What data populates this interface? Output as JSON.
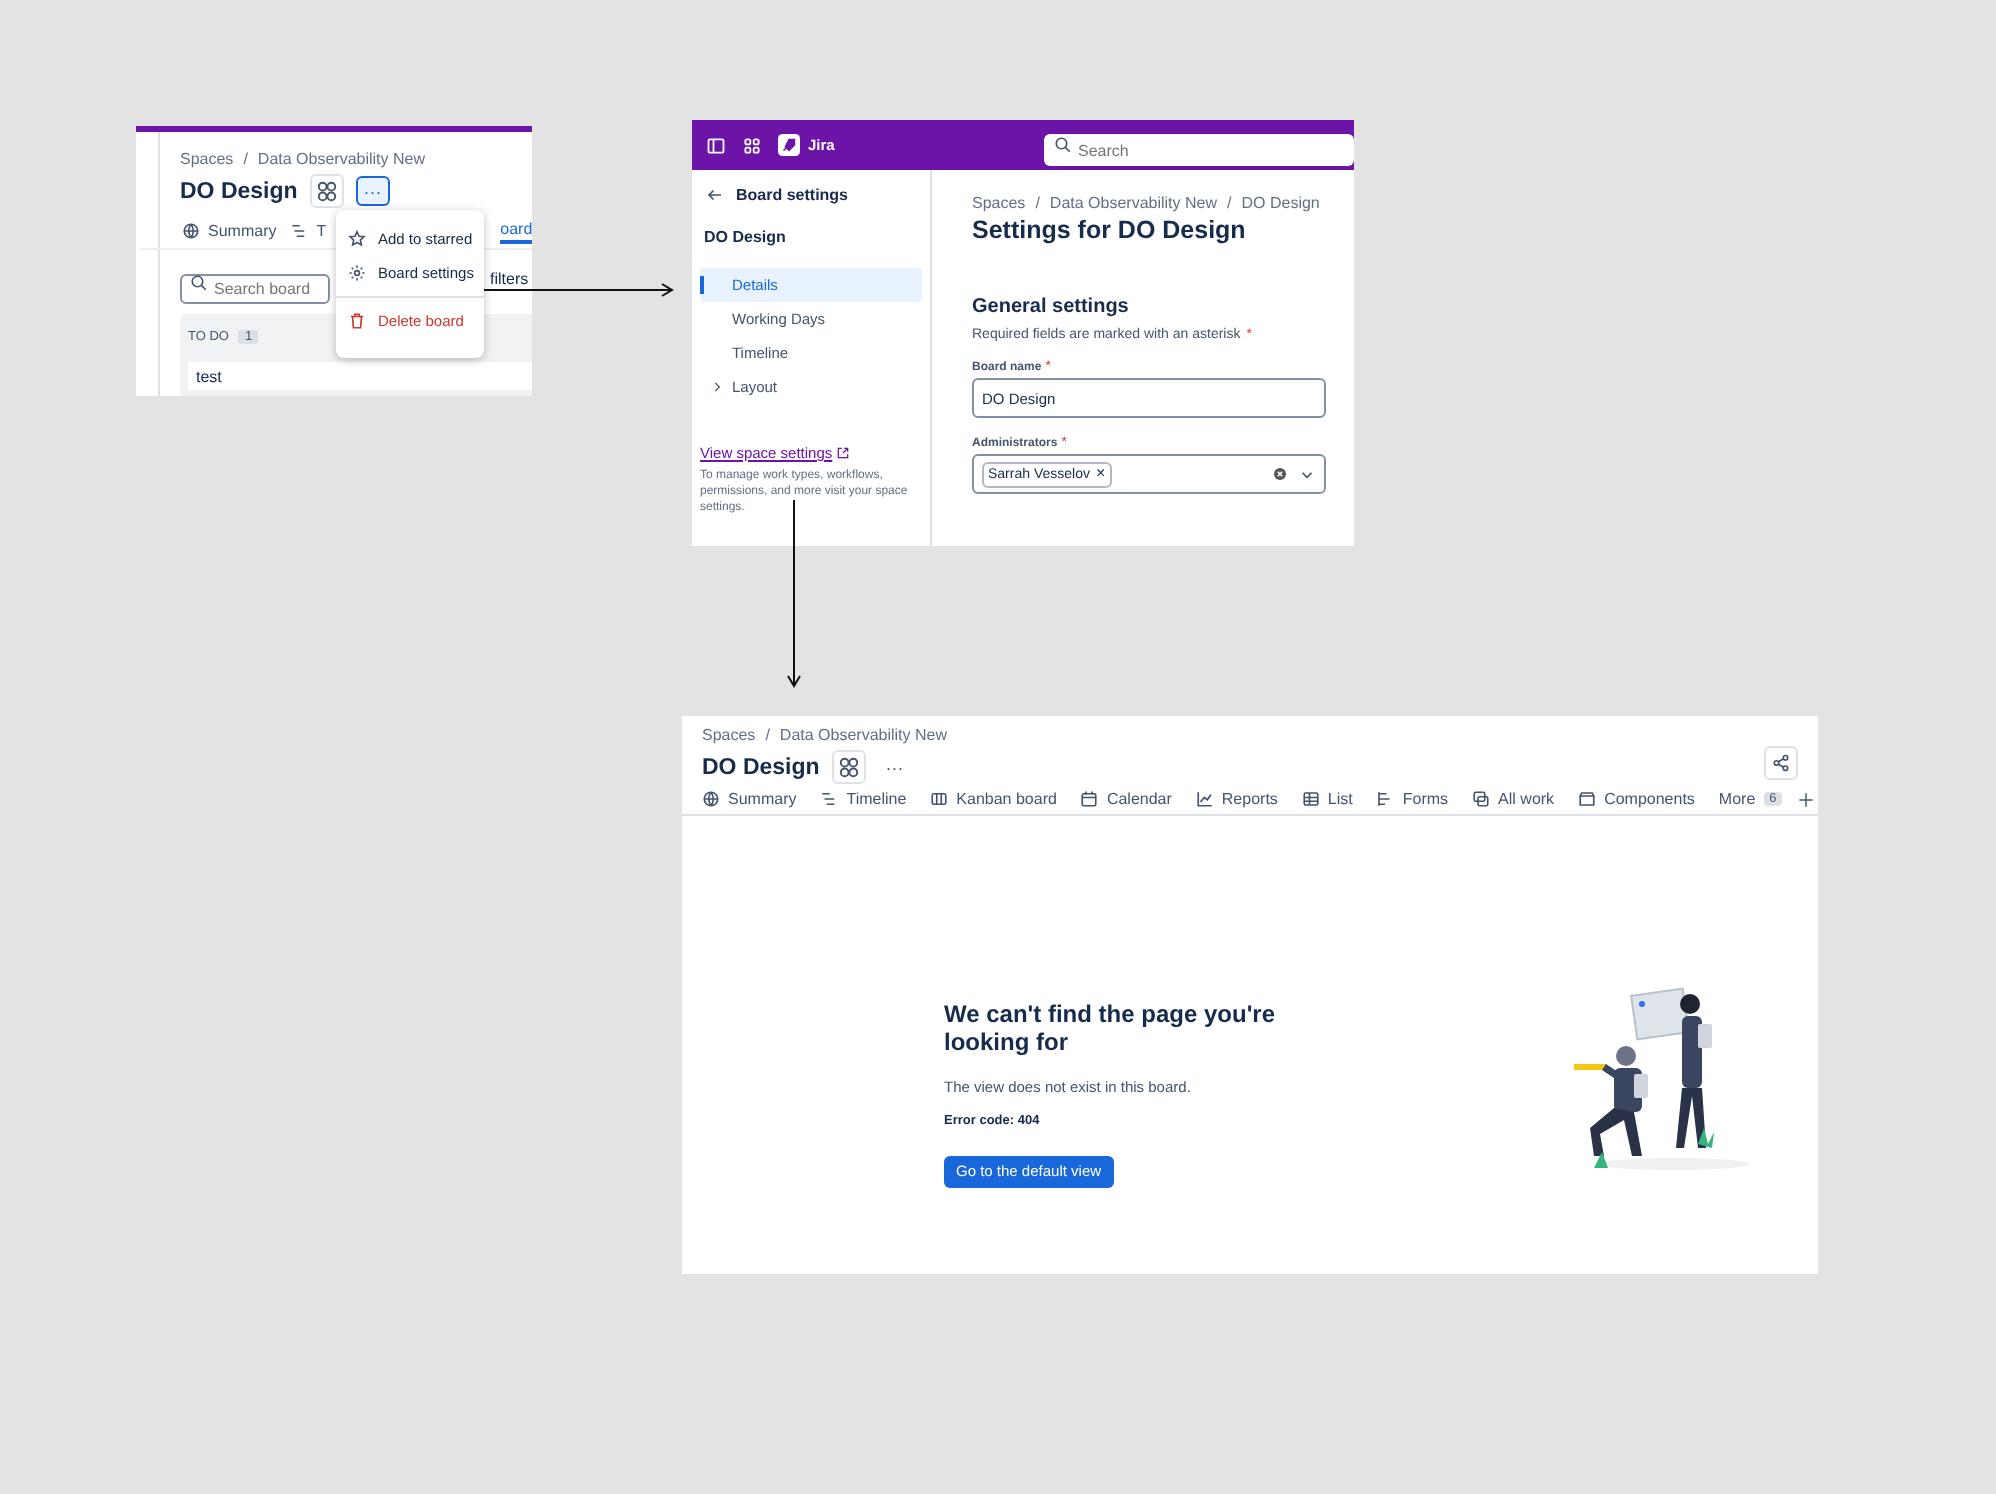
{
  "board_menu_panel": {
    "breadcrumb": [
      "Spaces",
      "Data Observability New"
    ],
    "separator": "/",
    "title": "DO Design",
    "more_button": {
      "label": "···",
      "active": true
    },
    "tabs": [
      {
        "label": "Summary",
        "selected": false
      },
      {
        "label": "T",
        "selected": false
      },
      {
        "label": "oard",
        "selected": true
      }
    ],
    "search": {
      "placeholder": "Search board"
    },
    "filters_label": "filters",
    "column": {
      "title": "TO DO",
      "count": "1",
      "cards": [
        "test"
      ]
    },
    "menu": [
      {
        "label": "Add to starred",
        "kind": "normal"
      },
      {
        "label": "Board settings",
        "kind": "normal"
      },
      {
        "label": "Delete board",
        "kind": "danger"
      }
    ]
  },
  "board_settings_panel": {
    "topbar": {
      "product": "Jira",
      "search": {
        "placeholder": "Search"
      }
    },
    "sidebar": {
      "back_title": "Board settings",
      "board": "DO Design",
      "items": [
        {
          "label": "Details",
          "kind": "page",
          "selected": true
        },
        {
          "label": "Working Days",
          "kind": "page",
          "selected": false
        },
        {
          "label": "Timeline",
          "kind": "page",
          "selected": false
        },
        {
          "label": "Layout",
          "kind": "group",
          "selected": false,
          "expanded": false
        }
      ],
      "link": "View space settings",
      "description": "To manage work types, workflows, permissions, and more visit your space settings."
    },
    "breadcrumb": [
      "Spaces",
      "Data Observability New",
      "DO Design"
    ],
    "separator": "/",
    "title": "Settings for DO Design",
    "section": "General settings",
    "note": "Required fields are marked with an asterisk",
    "note_mark": "*",
    "fields": [
      {
        "label": "Board name",
        "mark": "*",
        "kind": "text",
        "value": "DO Design"
      },
      {
        "label": "Administrators",
        "mark": "*",
        "kind": "select",
        "tags": [
          "Sarrah Vesselov"
        ],
        "tag_remove": "×"
      }
    ]
  },
  "board_view_panel": {
    "breadcrumb": [
      "Spaces",
      "Data Observability New"
    ],
    "separator": "/",
    "title": "DO Design",
    "more_button": {
      "label": "···",
      "active": false
    },
    "tabs": [
      {
        "label": "Summary"
      },
      {
        "label": "Timeline"
      },
      {
        "label": "Kanban board"
      },
      {
        "label": "Calendar"
      },
      {
        "label": "Reports"
      },
      {
        "label": "List"
      },
      {
        "label": "Forms"
      },
      {
        "label": "All work"
      },
      {
        "label": "Components"
      },
      {
        "label": "More",
        "count": "6"
      }
    ],
    "empty_state": {
      "heading": "We can't find the page you're looking for",
      "text": "The view does not exist in this board.",
      "error_code": "Error code: 404",
      "button": "Go to the default view"
    }
  }
}
